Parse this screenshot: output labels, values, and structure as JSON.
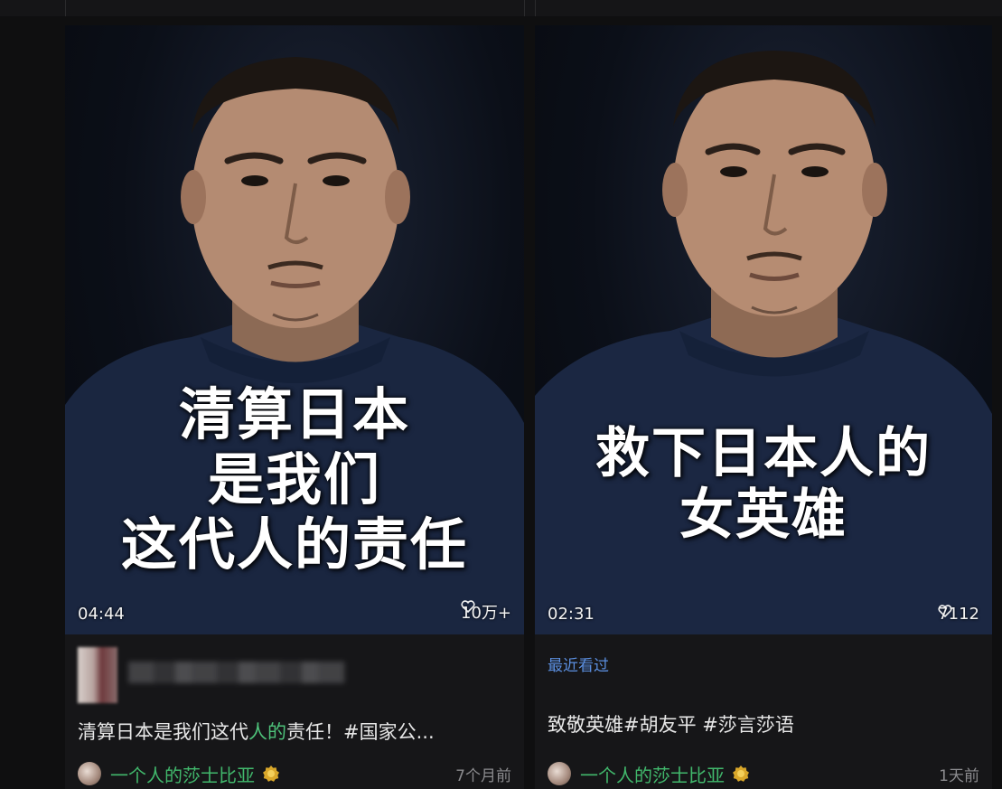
{
  "cards": [
    {
      "caption_lines": [
        "清算日本",
        "是我们",
        "这代人的责任"
      ],
      "duration": "04:44",
      "likes": "10万+",
      "recent_tag": "",
      "title_parts": [
        "清算日本是我们这代",
        "人的",
        "责任！#国家公..."
      ],
      "author": "一个人的莎士比亚",
      "time_ago": "7个月前"
    },
    {
      "caption_lines": [
        "救下日本人的",
        "女英雄"
      ],
      "duration": "02:31",
      "likes": "7112",
      "recent_tag": "最近看过",
      "title_parts": [
        "致敬英雄#胡友平 #莎言莎语"
      ],
      "author": "一个人的莎士比亚",
      "time_ago": "1天前"
    }
  ],
  "icons": {
    "like": "heart-outline-icon",
    "verified": "gold-badge-icon"
  },
  "colors": {
    "background": "#0f0f10",
    "author_green": "#41b86c",
    "highlight_green": "#4ec27a",
    "recent_blue": "#5b8fe0"
  }
}
